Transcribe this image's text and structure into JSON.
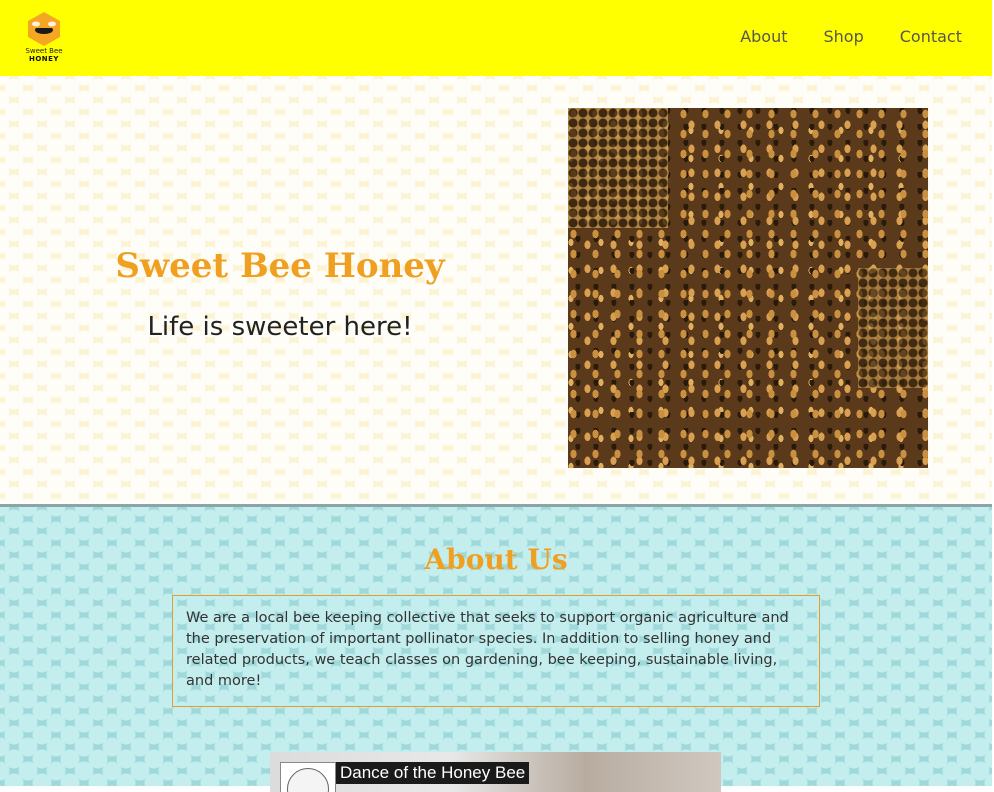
{
  "header": {
    "logo": {
      "line1": "Sweet Bee",
      "line2": "HONEY"
    },
    "nav": [
      "About",
      "Shop",
      "Contact"
    ]
  },
  "hero": {
    "title": "Sweet Bee Honey",
    "subtitle": "Life is sweeter here!"
  },
  "about": {
    "title": "About Us",
    "text": "We are a local bee keeping collective that seeks to support organic agriculture and the preservation of important pollinator species. In addition to selling honey and related products, we teach classes on gardening, bee keeping, sustainable living, and more!"
  },
  "video": {
    "title": "Dance of the Honey Bee"
  },
  "colors": {
    "header_bg": "#ffff00",
    "accent": "#f0a020",
    "about_bg": "#9fd8da"
  }
}
